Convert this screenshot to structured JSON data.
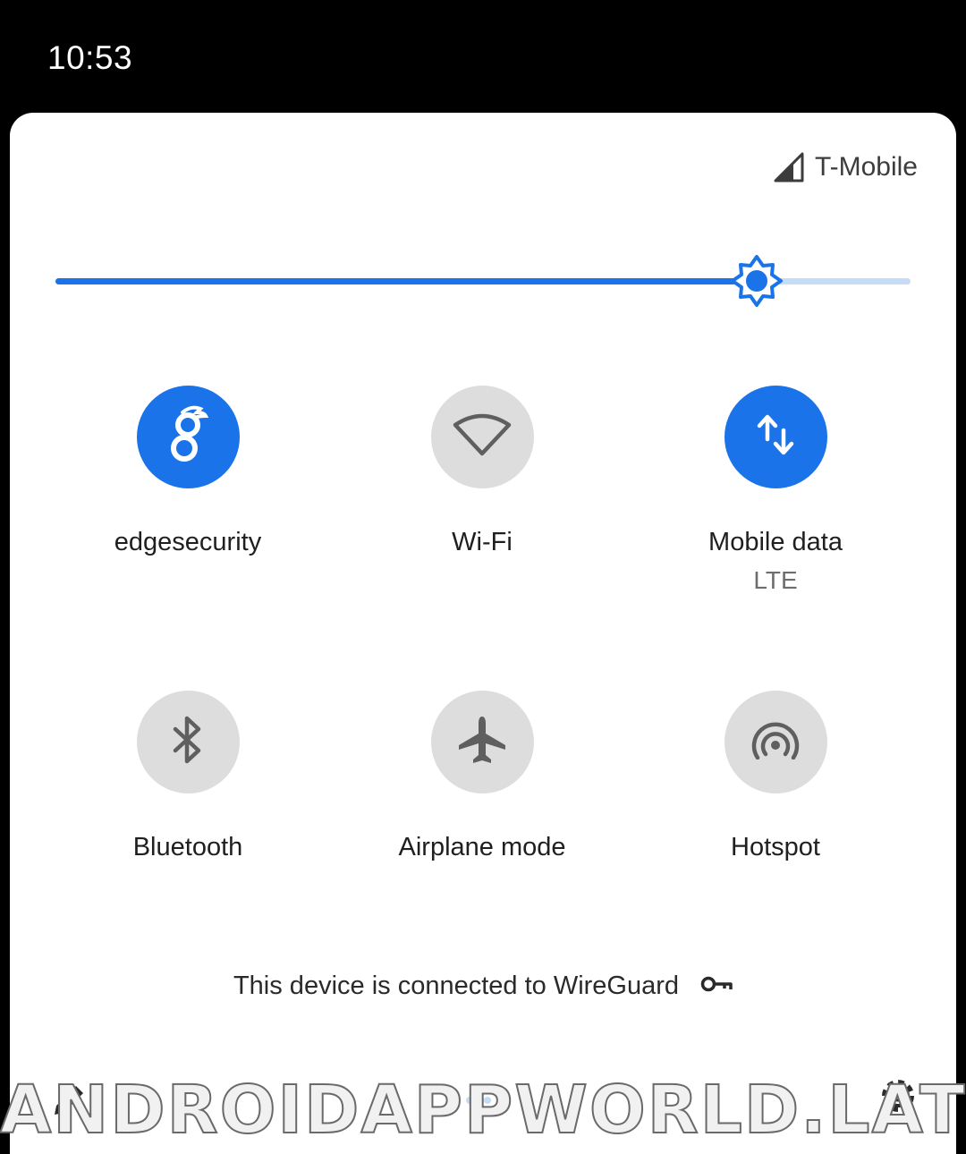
{
  "status_bar": {
    "time": "10:53"
  },
  "carrier": {
    "name": "T-Mobile",
    "icon": "signal-icon"
  },
  "brightness": {
    "level": 0.82,
    "icon": "brightness-icon"
  },
  "tiles": [
    {
      "label": "edgesecurity",
      "sublabel": "",
      "active": true,
      "icon": "wireguard-dragon-icon"
    },
    {
      "label": "Wi-Fi",
      "sublabel": "",
      "active": false,
      "icon": "wifi-icon"
    },
    {
      "label": "Mobile data",
      "sublabel": "LTE",
      "active": true,
      "icon": "mobile-data-icon"
    },
    {
      "label": "Bluetooth",
      "sublabel": "",
      "active": false,
      "icon": "bluetooth-icon"
    },
    {
      "label": "Airplane mode",
      "sublabel": "",
      "active": false,
      "icon": "airplane-icon"
    },
    {
      "label": "Hotspot",
      "sublabel": "",
      "active": false,
      "icon": "hotspot-icon"
    }
  ],
  "vpn_notice": {
    "text": "This device is connected to WireGuard",
    "icon": "vpn-key-icon"
  },
  "footer": {
    "edit_icon": "edit-icon",
    "settings_icon": "settings-icon",
    "pages": 3,
    "current_page": 1
  },
  "watermark": {
    "text": "ANDROIDAPPWORLD.LAT"
  },
  "colors": {
    "accent": "#1a73e8",
    "accent_light": "#c6dbf7",
    "tile_off": "#dddddd",
    "icon_off": "#5f5f5f"
  }
}
